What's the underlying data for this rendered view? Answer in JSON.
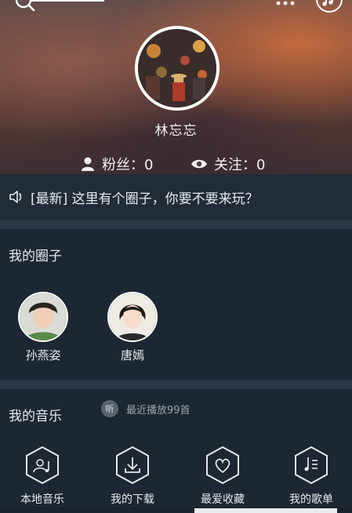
{
  "header": {
    "username": "林忘忘",
    "stats": {
      "fans_label": "粉丝：",
      "fans_count": "0",
      "follow_label": "关注：",
      "follow_count": "0"
    }
  },
  "notice": {
    "text": "[最新] 这里有个圈子，你要不要来玩？"
  },
  "circles": {
    "title": "我的圈子",
    "members": [
      {
        "name": "孙燕姿"
      },
      {
        "name": "唐嫣"
      }
    ]
  },
  "music": {
    "title": "我的音乐",
    "recent_badge": "听",
    "recent_text": "最近播放99首",
    "tiles": [
      {
        "label": "本地音乐",
        "icon": "local-music-icon"
      },
      {
        "label": "我的下载",
        "icon": "download-icon"
      },
      {
        "label": "最爱收藏",
        "icon": "favorite-icon"
      },
      {
        "label": "我的歌单",
        "icon": "playlist-icon"
      }
    ]
  },
  "colors": {
    "background": "#1f2a36",
    "notice_bg": "#222c38",
    "band": "#2a3644",
    "text": "#e6e9ec",
    "muted": "#9aa5b0"
  }
}
